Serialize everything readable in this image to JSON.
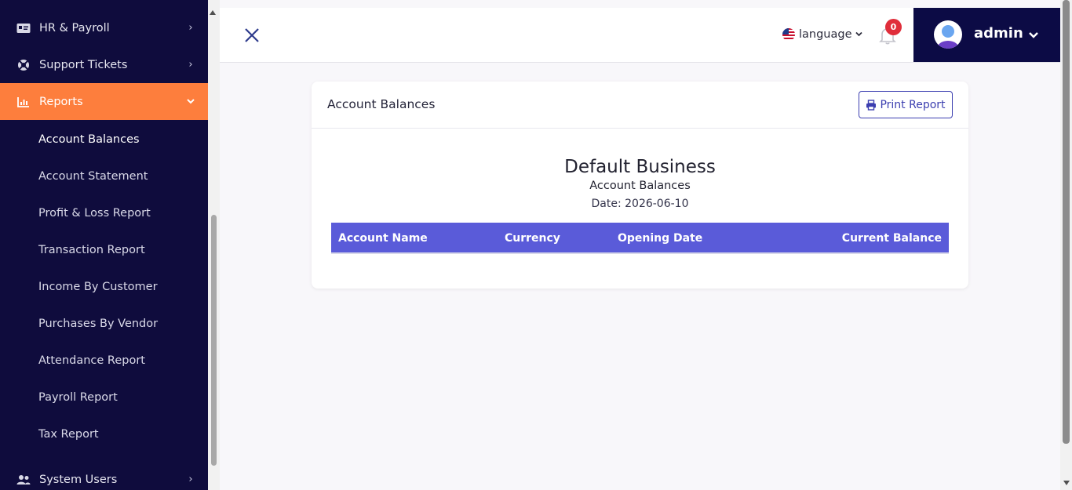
{
  "sidebar": {
    "top_items": [
      {
        "label": "HR & Payroll",
        "icon": "id-card-icon"
      },
      {
        "label": "Support Tickets",
        "icon": "life-ring-icon"
      },
      {
        "label": "Reports",
        "icon": "bar-chart-icon"
      }
    ],
    "report_subitems": [
      {
        "label": "Account Balances"
      },
      {
        "label": "Account Statement"
      },
      {
        "label": "Profit & Loss Report"
      },
      {
        "label": "Transaction Report"
      },
      {
        "label": "Income By Customer"
      },
      {
        "label": "Purchases By Vendor"
      },
      {
        "label": "Attendance Report"
      },
      {
        "label": "Payroll Report"
      },
      {
        "label": "Tax Report"
      }
    ],
    "bottom_item": {
      "label": "System Users",
      "icon": "users-icon"
    },
    "active_color": "#fd7e3d",
    "background_color": "#0f0c3d"
  },
  "header": {
    "language_label": "language",
    "notification_count": "0",
    "username": "admin"
  },
  "card": {
    "title": "Account Balances",
    "print_label": "Print Report",
    "business_name": "Default Business",
    "report_name": "Account Balances",
    "date_text": "Date: 2026-06-10",
    "columns": [
      "Account Name",
      "Currency",
      "Opening Date",
      "Current Balance"
    ],
    "header_color": "#5a5bd9"
  }
}
